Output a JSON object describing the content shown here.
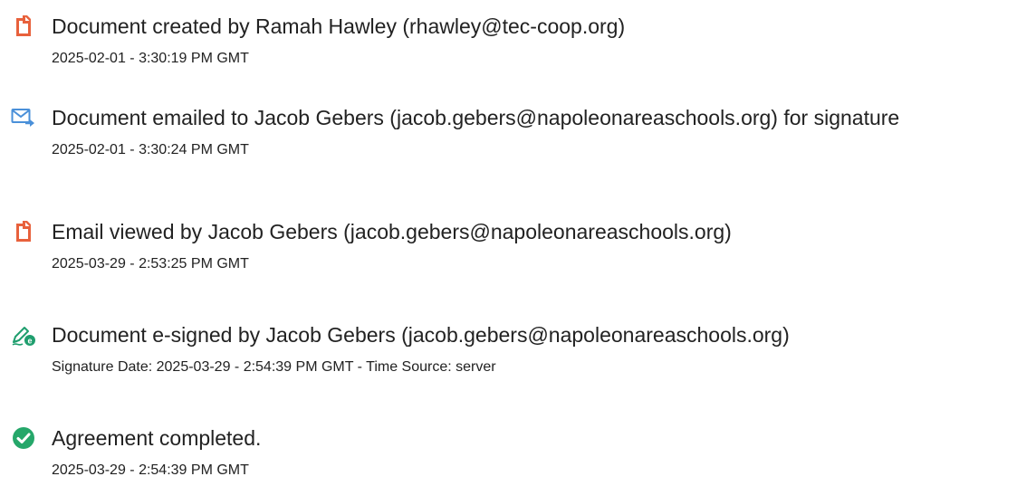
{
  "events": [
    {
      "icon": "document-icon",
      "title": "Document created by Ramah Hawley (rhawley@tec-coop.org)",
      "detail": "2025-02-01 - 3:30:19 PM GMT"
    },
    {
      "icon": "email-sent-icon",
      "title": "Document emailed to Jacob Gebers (jacob.gebers@napoleonareaschools.org) for signature",
      "detail": "2025-02-01 - 3:30:24 PM GMT"
    },
    {
      "icon": "document-icon",
      "title": "Email viewed by Jacob Gebers (jacob.gebers@napoleonareaschools.org)",
      "detail": "2025-03-29 - 2:53:25 PM GMT"
    },
    {
      "icon": "e-sign-pen-icon",
      "title": "Document e-signed by Jacob Gebers (jacob.gebers@napoleonareaschools.org)",
      "detail": "Signature Date: 2025-03-29 - 2:54:39 PM GMT - Time Source: server"
    },
    {
      "icon": "check-circle-icon",
      "title": "Agreement completed.",
      "detail": "2025-03-29 - 2:54:39 PM GMT"
    }
  ],
  "colors": {
    "document_icon": "#E8613C",
    "email_icon": "#4A90D9",
    "sign_icon": "#1F9E6E",
    "check_icon": "#25A76A",
    "text": "#222222"
  }
}
